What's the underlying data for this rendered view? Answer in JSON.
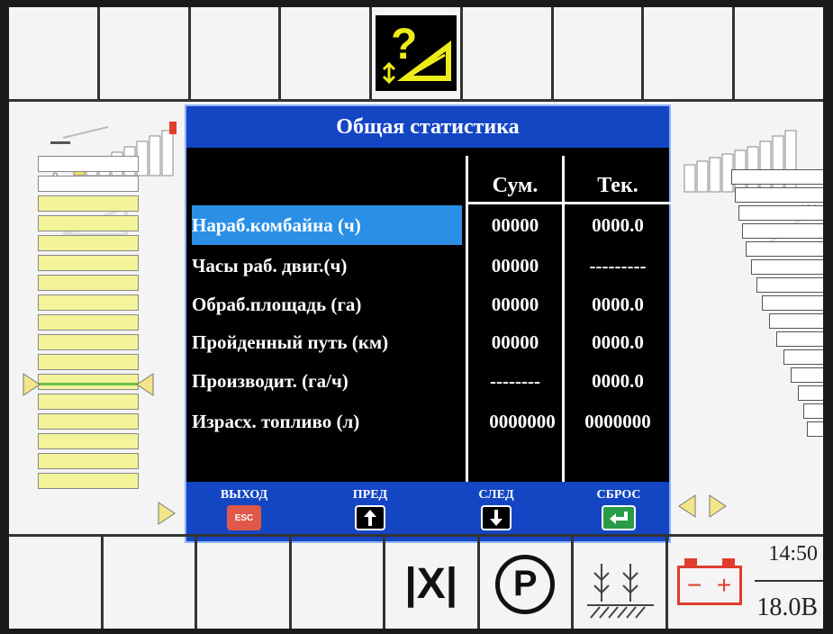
{
  "dialog": {
    "title": "Общая статистика",
    "col_sum": "Сум.",
    "col_cur": "Тек.",
    "rows": [
      {
        "label": "Нараб.комбайна (ч)",
        "sum": "00000",
        "cur": "0000.0"
      },
      {
        "label": "Часы раб. двиг.(ч)",
        "sum": "00000",
        "cur": "---------"
      },
      {
        "label": "Обраб.площадь (га)",
        "sum": "00000",
        "cur": "0000.0"
      },
      {
        "label": "Пройденный путь (км)",
        "sum": "00000",
        "cur": "0000.0"
      },
      {
        "label": "Производит. (га/ч)",
        "sum": "--------",
        "cur": "0000.0"
      },
      {
        "label": "Израсх. топливо (л)",
        "sum": "0000000",
        "cur": "0000000"
      }
    ],
    "footer": {
      "exit_label": "ВЫХОД",
      "esc_key": "ESC",
      "prev_label": "ПРЕД",
      "next_label": "СЛЕД",
      "reset_label": "СБРОС"
    }
  },
  "gauges": {
    "left_min": "0",
    "right_max": "100"
  },
  "status": {
    "time": "14:50",
    "voltage": "18.0В",
    "battery_minus": "−",
    "battery_plus": "+",
    "parking_symbol": "P",
    "neutral_symbol": "|X|"
  },
  "icons": {
    "warning": "help-warning-icon",
    "battery": "battery-icon",
    "parking": "parking-brake-icon",
    "neutral": "neutral-gear-icon",
    "crop": "crop-field-icon"
  },
  "colors": {
    "dialog_header": "#1446c4",
    "selection": "#2b8fe6",
    "warning_yellow": "#ecec1a",
    "gauge_yellow": "#f3f39a",
    "battery_red": "#e03c2c"
  }
}
